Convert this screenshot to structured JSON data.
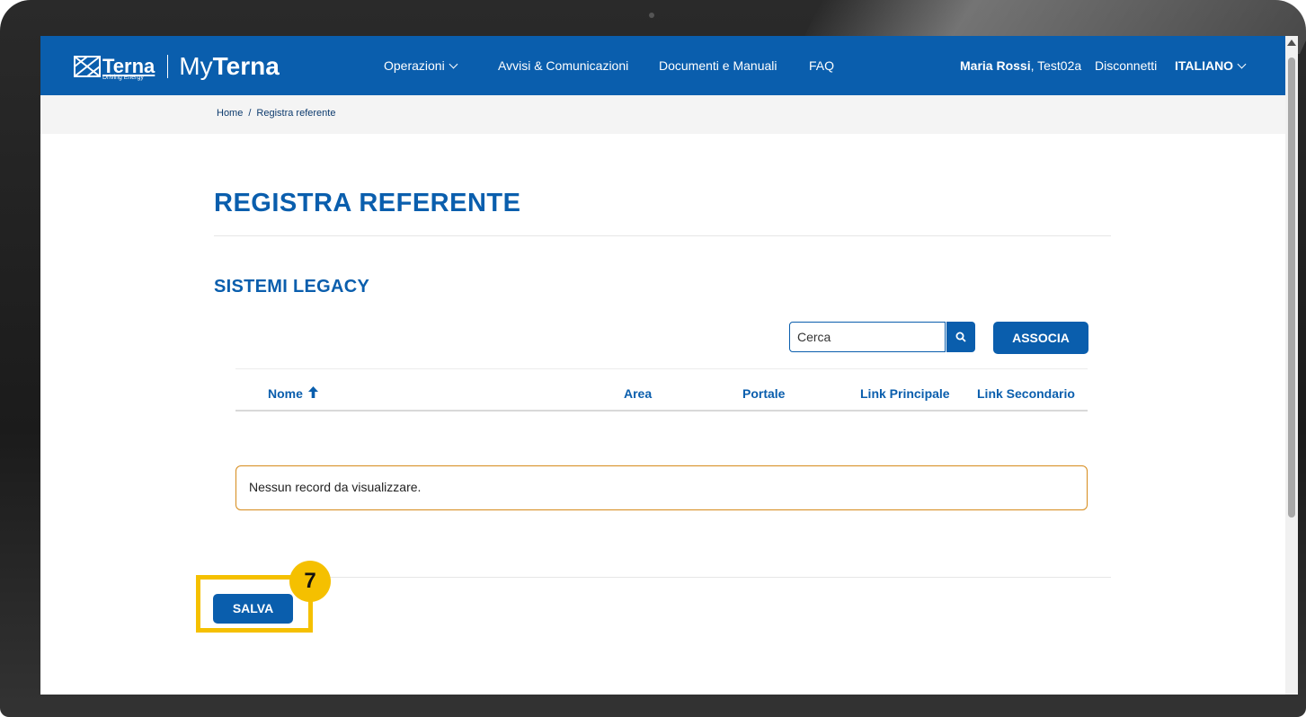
{
  "header": {
    "logo_brand": "Terna",
    "logo_tagline": "Driving Energy",
    "logo_my_prefix": "My",
    "logo_my_suffix": "Terna",
    "nav": [
      {
        "label": "Operazioni",
        "has_dropdown": true
      },
      {
        "label": "Avvisi & Comunicazioni"
      },
      {
        "label": "Documenti e Manuali"
      },
      {
        "label": "FAQ"
      }
    ],
    "user_name": "Maria Rossi",
    "user_account": ", Test02a",
    "logout_label": "Disconnetti",
    "language_label": "ITALIANO"
  },
  "breadcrumb": {
    "home": "Home",
    "separator": "/",
    "current": "Registra referente"
  },
  "page": {
    "title": "REGISTRA REFERENTE",
    "section_title": "SISTEMI LEGACY"
  },
  "search": {
    "placeholder": "Cerca",
    "icon": "search-icon"
  },
  "associa_label": "ASSOCIA",
  "table": {
    "columns": [
      "Nome",
      "Area",
      "Portale",
      "Link Principale",
      "Link Secondario"
    ],
    "sort_column": "Nome",
    "sort_direction": "ascending",
    "empty_message": "Nessun record da visualizzare."
  },
  "salva_label": "SALVA",
  "annotation": {
    "step_number": "7"
  },
  "colors": {
    "brand_blue": "#0a5ead",
    "highlight_yellow": "#f5c000",
    "empty_border": "#d68b1b"
  }
}
